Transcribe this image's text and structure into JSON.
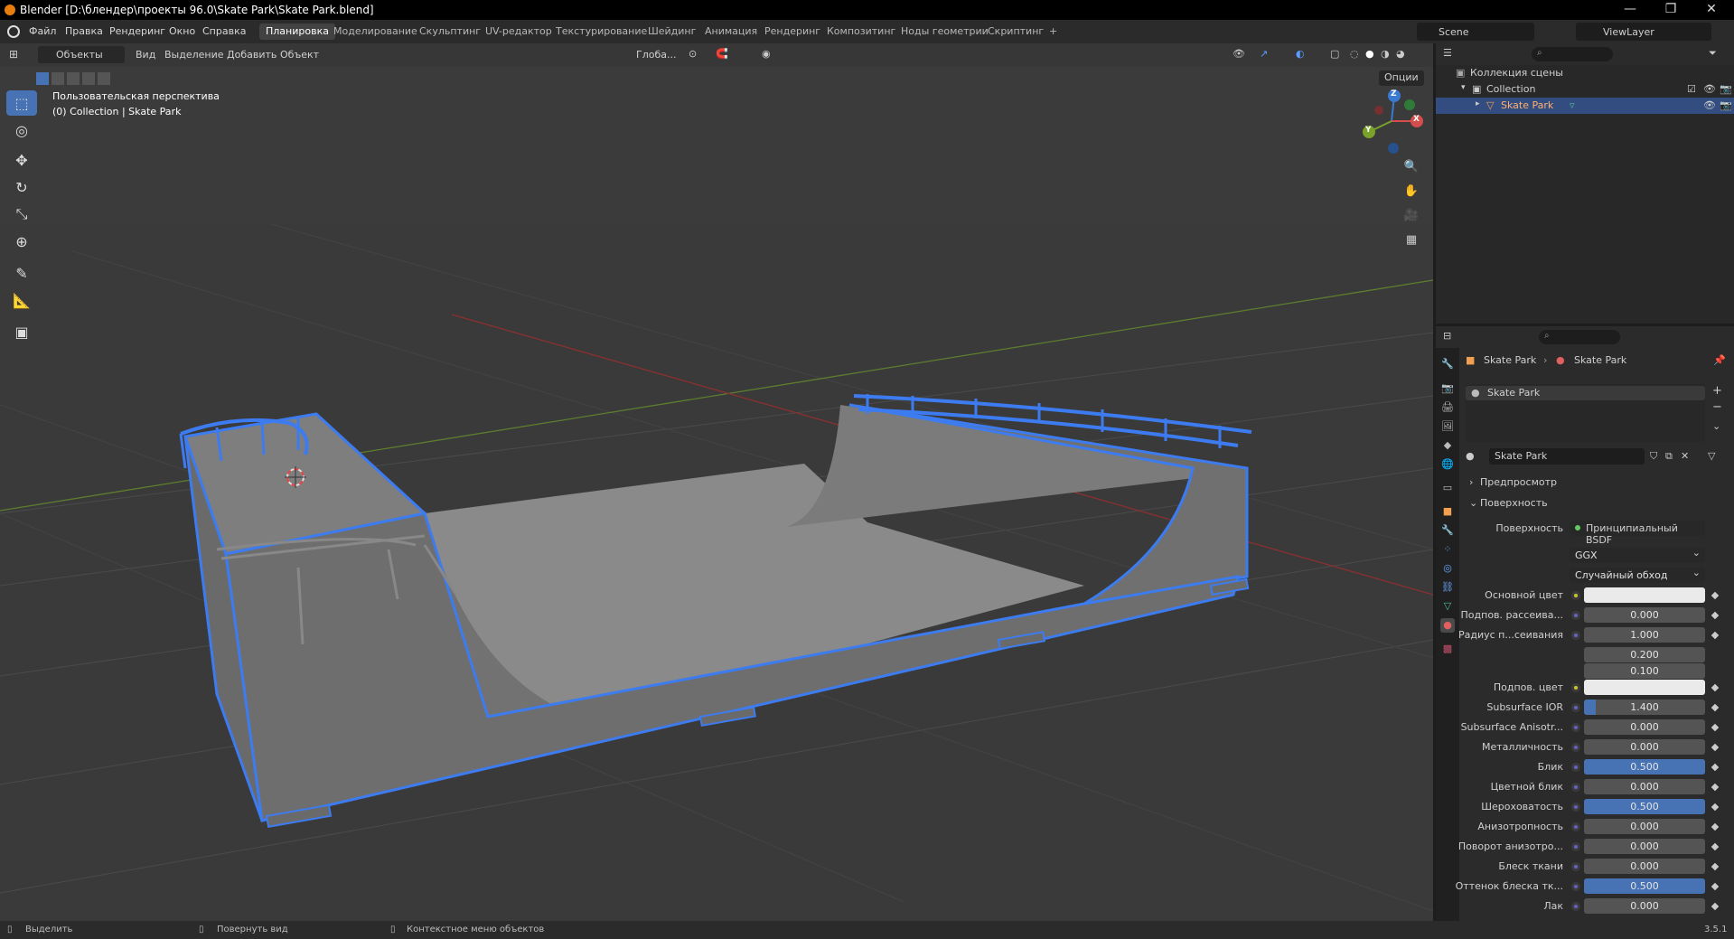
{
  "window": {
    "title": "Blender [D:\\блендер\\проекты 96.0\\Skate Park\\Skate Park.blend]",
    "minimize": "—",
    "maximize": "❐",
    "close": "✕"
  },
  "menu": {
    "items": [
      "Файл",
      "Правка",
      "Рендеринг",
      "Окно",
      "Справка"
    ],
    "workspaces": [
      "Планировка",
      "Моделирование",
      "Скульптинг",
      "UV-редактор",
      "Текстурирование",
      "Шейдинг",
      "Анимация",
      "Рендеринг",
      "Композитинг",
      "Ноды геометрии",
      "Скриптинг"
    ],
    "add_workspace": "+",
    "scene": "Scene",
    "view_layer": "ViewLayer"
  },
  "viewport": {
    "mode": "Объекты",
    "menus": [
      "Вид",
      "Выделение",
      "Добавить",
      "Объект"
    ],
    "orientation": "Глоба...",
    "options": "Опции",
    "info_line1": "Пользовательская перспектива",
    "info_line2": "(0) Collection | Skate Park",
    "gizmo": {
      "x": "X",
      "y": "Y",
      "z": "Z"
    }
  },
  "outliner": {
    "scene_collection": "Коллекция сцены",
    "collection": "Collection",
    "object": "Skate Park"
  },
  "properties": {
    "breadcrumb_object": "Skate Park",
    "breadcrumb_material": "Skate Park",
    "slot_name": "Skate Park",
    "material_name": "Skate Park",
    "panel_preview": "Предпросмотр",
    "panel_surface": "Поверхность",
    "surface_label": "Поверхность",
    "surface_value": "Принципиальный BSDF",
    "distribution": "GGX",
    "subsurface_method": "Случайный обход",
    "rows": [
      {
        "label": "Основной цвет",
        "type": "color",
        "value": ""
      },
      {
        "label": "Подпов. рассеива...",
        "type": "num",
        "value": "0.000",
        "fill": 0
      },
      {
        "label": "Радиус п...сеивания",
        "type": "num",
        "value": "1.000",
        "fill": 0
      },
      {
        "label": "",
        "type": "num",
        "value": "0.200",
        "fill": 0
      },
      {
        "label": "",
        "type": "num",
        "value": "0.100",
        "fill": 0
      },
      {
        "label": "Подпов. цвет",
        "type": "color",
        "value": ""
      },
      {
        "label": "Subsurface IOR",
        "type": "num",
        "value": "1.400",
        "fill": 0.1
      },
      {
        "label": "Subsurface Anisotr...",
        "type": "num",
        "value": "0.000",
        "fill": 0
      },
      {
        "label": "Металличность",
        "type": "num",
        "value": "0.000",
        "fill": 0
      },
      {
        "label": "Блик",
        "type": "num",
        "value": "0.500",
        "fill": 1
      },
      {
        "label": "Цветной блик",
        "type": "num",
        "value": "0.000",
        "fill": 0
      },
      {
        "label": "Шероховатость",
        "type": "num",
        "value": "0.500",
        "fill": 1
      },
      {
        "label": "Анизотропность",
        "type": "num",
        "value": "0.000",
        "fill": 0
      },
      {
        "label": "Поворот анизотро...",
        "type": "num",
        "value": "0.000",
        "fill": 0
      },
      {
        "label": "Блеск ткани",
        "type": "num",
        "value": "0.000",
        "fill": 0
      },
      {
        "label": "Оттенок блеска тк...",
        "type": "num",
        "value": "0.500",
        "fill": 1
      },
      {
        "label": "Лак",
        "type": "num",
        "value": "0.000",
        "fill": 0
      }
    ]
  },
  "status": {
    "select": "Выделить",
    "rotate": "Повернуть вид",
    "context": "Контекстное меню объектов",
    "version": "3.5.1"
  },
  "colors": {
    "accent": "#4772b3",
    "selection_outline": "#3d7cf0",
    "viewport_bg": "#3b3b3b"
  }
}
